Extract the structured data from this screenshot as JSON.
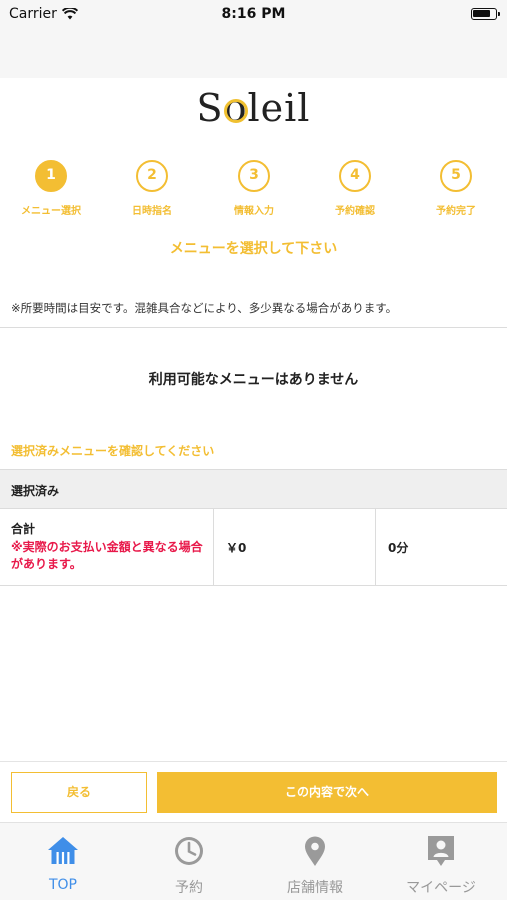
{
  "status_bar": {
    "carrier": "Carrier",
    "time": "8:16 PM"
  },
  "brand": {
    "logo_text": "Soleil",
    "accent_color": "#f3be33"
  },
  "steps": [
    {
      "number": "1",
      "label": "メニュー選択",
      "active": true
    },
    {
      "number": "2",
      "label": "日時指名",
      "active": false
    },
    {
      "number": "3",
      "label": "情報入力",
      "active": false
    },
    {
      "number": "4",
      "label": "予約確認",
      "active": false
    },
    {
      "number": "5",
      "label": "予約完了",
      "active": false
    }
  ],
  "instruction": "メニューを選択して下さい",
  "note": "※所要時間は目安です。混雑具合などにより、多少異なる場合があります。",
  "empty_message": "利用可能なメニューはありません",
  "confirm_label": "選択済みメニューを確認してください",
  "selected": {
    "header": "選択済み",
    "total_label": "合計",
    "warning": "※実際のお支払い金額と異なる場合があります。",
    "warning_color": "#e8194a",
    "price": "￥0",
    "duration": "0分"
  },
  "buttons": {
    "back": "戻る",
    "next": "この内容で次へ"
  },
  "tabs": [
    {
      "label": "TOP",
      "icon": "home-icon",
      "active": true
    },
    {
      "label": "予約",
      "icon": "clock-icon",
      "active": false
    },
    {
      "label": "店舗情報",
      "icon": "map-pin-icon",
      "active": false
    },
    {
      "label": "マイページ",
      "icon": "profile-card-icon",
      "active": false
    }
  ]
}
